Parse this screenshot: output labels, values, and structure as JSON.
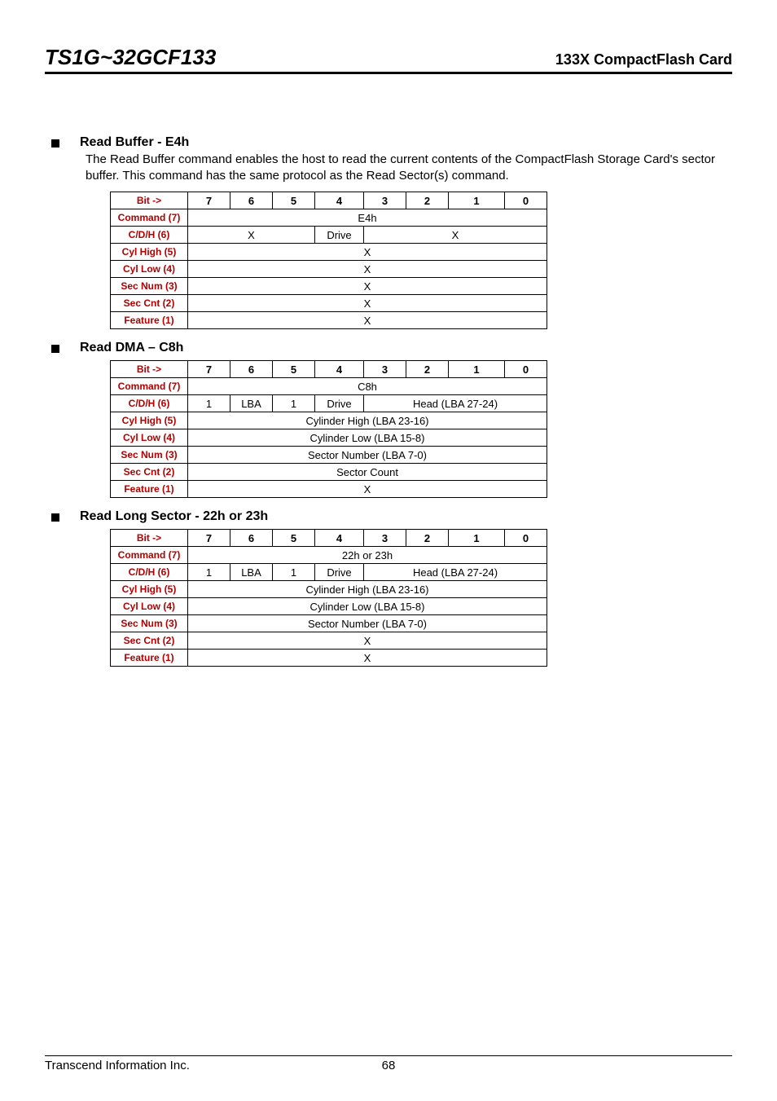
{
  "header": {
    "model": "TS1G~32GCF133",
    "product": "133X CompactFlash Card"
  },
  "sections": [
    {
      "title": "Read Buffer - E4h",
      "desc": "The Read Buffer command enables the host to read the current contents of the CompactFlash Storage Card's sector buffer. This command has the same protocol as the Read Sector(s) command.",
      "table": {
        "bit_label": "Bit ->",
        "bits": [
          "7",
          "6",
          "5",
          "4",
          "3",
          "2",
          "1",
          "0"
        ],
        "rows": [
          {
            "label": "Command (7)",
            "cells": [
              {
                "span": 8,
                "text": "E4h"
              }
            ]
          },
          {
            "label": "C/D/H (6)",
            "cells": [
              {
                "span": 3,
                "text": "X"
              },
              {
                "span": 1,
                "text": "Drive"
              },
              {
                "span": 4,
                "text": "X"
              }
            ]
          },
          {
            "label": "Cyl High (5)",
            "cells": [
              {
                "span": 8,
                "text": "X"
              }
            ]
          },
          {
            "label": "Cyl Low (4)",
            "cells": [
              {
                "span": 8,
                "text": "X"
              }
            ]
          },
          {
            "label": "Sec Num (3)",
            "cells": [
              {
                "span": 8,
                "text": "X"
              }
            ]
          },
          {
            "label": "Sec Cnt (2)",
            "cells": [
              {
                "span": 8,
                "text": "X"
              }
            ]
          },
          {
            "label": "Feature (1)",
            "cells": [
              {
                "span": 8,
                "text": "X"
              }
            ]
          }
        ]
      }
    },
    {
      "title": "Read DMA – C8h",
      "desc": "",
      "table": {
        "bit_label": "Bit ->",
        "bits": [
          "7",
          "6",
          "5",
          "4",
          "3",
          "2",
          "1",
          "0"
        ],
        "rows": [
          {
            "label": "Command (7)",
            "cells": [
              {
                "span": 8,
                "text": "C8h"
              }
            ]
          },
          {
            "label": "C/D/H (6)",
            "cells": [
              {
                "span": 1,
                "text": "1"
              },
              {
                "span": 1,
                "text": "LBA"
              },
              {
                "span": 1,
                "text": "1"
              },
              {
                "span": 1,
                "text": "Drive"
              },
              {
                "span": 4,
                "text": "Head (LBA 27-24)"
              }
            ]
          },
          {
            "label": "Cyl High (5)",
            "cells": [
              {
                "span": 8,
                "text": "Cylinder High (LBA 23-16)"
              }
            ]
          },
          {
            "label": "Cyl Low (4)",
            "cells": [
              {
                "span": 8,
                "text": "Cylinder Low (LBA 15-8)"
              }
            ]
          },
          {
            "label": "Sec Num (3)",
            "cells": [
              {
                "span": 8,
                "text": "Sector Number (LBA 7-0)"
              }
            ]
          },
          {
            "label": "Sec Cnt (2)",
            "cells": [
              {
                "span": 8,
                "text": "Sector Count"
              }
            ]
          },
          {
            "label": "Feature (1)",
            "cells": [
              {
                "span": 8,
                "text": "X"
              }
            ]
          }
        ]
      }
    },
    {
      "title": "Read Long Sector - 22h or 23h",
      "desc": "",
      "table": {
        "bit_label": "Bit ->",
        "bits": [
          "7",
          "6",
          "5",
          "4",
          "3",
          "2",
          "1",
          "0"
        ],
        "rows": [
          {
            "label": "Command (7)",
            "cells": [
              {
                "span": 8,
                "text": "22h or 23h"
              }
            ]
          },
          {
            "label": "C/D/H (6)",
            "cells": [
              {
                "span": 1,
                "text": "1"
              },
              {
                "span": 1,
                "text": "LBA"
              },
              {
                "span": 1,
                "text": "1"
              },
              {
                "span": 1,
                "text": "Drive"
              },
              {
                "span": 4,
                "text": "Head (LBA 27-24)"
              }
            ]
          },
          {
            "label": "Cyl High (5)",
            "cells": [
              {
                "span": 8,
                "text": "Cylinder High (LBA 23-16)"
              }
            ]
          },
          {
            "label": "Cyl Low (4)",
            "cells": [
              {
                "span": 8,
                "text": "Cylinder Low (LBA 15-8)"
              }
            ]
          },
          {
            "label": "Sec Num (3)",
            "cells": [
              {
                "span": 8,
                "text": "Sector Number (LBA 7-0)"
              }
            ]
          },
          {
            "label": "Sec Cnt (2)",
            "cells": [
              {
                "span": 8,
                "text": "X"
              }
            ]
          },
          {
            "label": "Feature (1)",
            "cells": [
              {
                "span": 8,
                "text": "X"
              }
            ]
          }
        ]
      }
    }
  ],
  "footer": {
    "company": "Transcend Information Inc.",
    "page": "68"
  }
}
